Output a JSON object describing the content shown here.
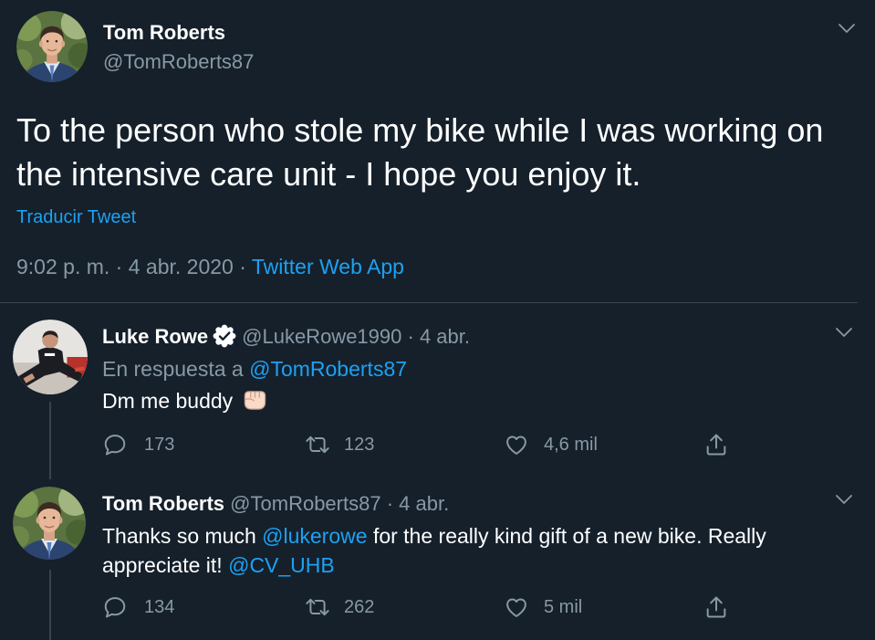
{
  "theme": {
    "background": "#15202b",
    "text": "#ffffff",
    "muted": "#8899a6",
    "link": "#1da1f2",
    "divider": "#38444d"
  },
  "main_tweet": {
    "author": {
      "name": "Tom Roberts",
      "handle": "@TomRoberts87",
      "avatar": "tom-roberts-avatar"
    },
    "menu_icon": "chevron-down-icon",
    "text": "To the person who stole my bike while I was working on the intensive care unit - I hope you enjoy it.",
    "translate_label": "Traducir Tweet",
    "time": "9:02 p. m.",
    "separator": "·",
    "date": "4 abr. 2020",
    "source": "Twitter Web App"
  },
  "replies": [
    {
      "name": "Luke Rowe",
      "verified": true,
      "verified_icon": "verified-badge-icon",
      "handle": "@LukeRowe1990",
      "separator": "·",
      "date": "4 abr.",
      "avatar": "luke-rowe-avatar",
      "reply_to_prefix": "En respuesta a",
      "reply_to_handle": "@TomRoberts87",
      "text": "Dm me buddy",
      "emoji": "oncoming-fist-light-skin-tone-emoji",
      "stats": {
        "replies": "173",
        "retweets": "123",
        "likes": "4,6 mil"
      }
    },
    {
      "name": "Tom Roberts",
      "handle": "@TomRoberts87",
      "separator": "·",
      "date": "4 abr.",
      "avatar": "tom-roberts-avatar",
      "body": {
        "before": "Thanks so much",
        "mention1": "@lukerowe",
        "middle": "for the really kind gift of a new bike. Really appreciate it!",
        "mention2": "@CV_UHB"
      },
      "stats": {
        "replies": "134",
        "retweets": "262",
        "likes": "5 mil"
      }
    }
  ],
  "action_icons": [
    "reply-icon",
    "retweet-icon",
    "like-icon",
    "share-icon"
  ]
}
